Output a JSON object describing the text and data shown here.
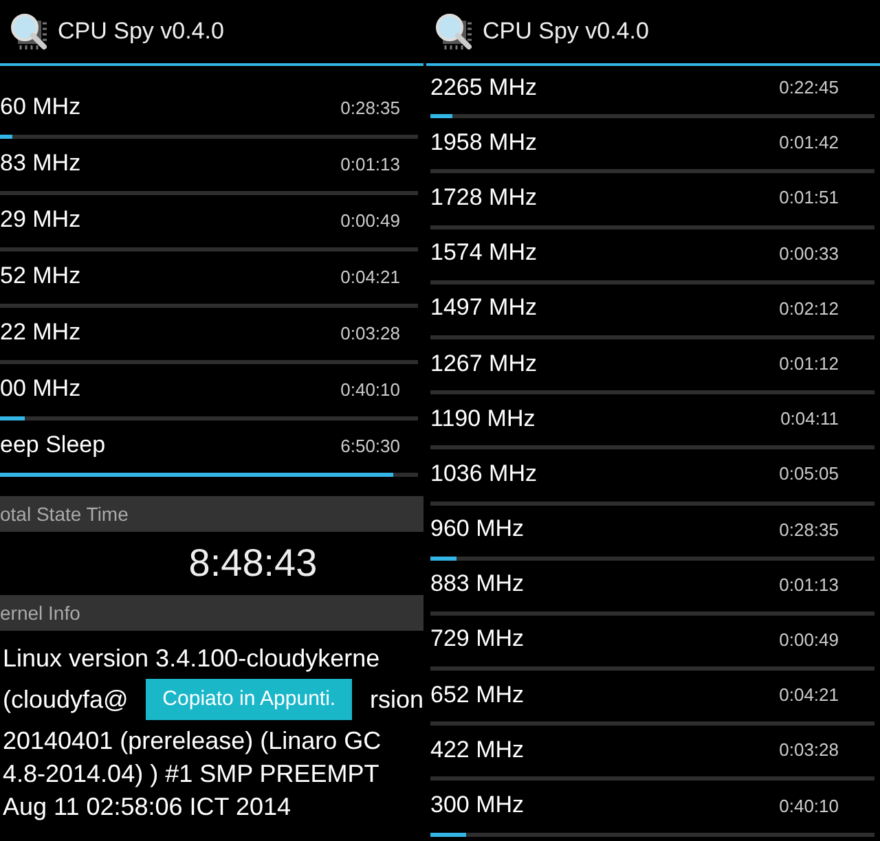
{
  "panels": [
    {
      "title": "CPU Spy v0.4.0",
      "states": [
        {
          "label": "60 MHz",
          "time": "0:28:35",
          "level": 0.03
        },
        {
          "label": "83 MHz",
          "time": "0:01:13",
          "level": 0
        },
        {
          "label": "29 MHz",
          "time": "0:00:49",
          "level": 0
        },
        {
          "label": "52 MHz",
          "time": "0:04:21",
          "level": 0
        },
        {
          "label": "22 MHz",
          "time": "0:03:28",
          "level": 0
        },
        {
          "label": "00 MHz",
          "time": "0:40:10",
          "level": 0.06
        },
        {
          "label": "eep Sleep",
          "time": "6:50:30",
          "level": 0.94
        }
      ],
      "total_header": "otal State Time",
      "total": "8:48:43",
      "kernel_header": "ernel Info",
      "kernel_lines": [
        {
          "text": "Linux version 3.4.100-cloudykerne"
        },
        {
          "left": "(cloudyfa@",
          "right": "rsion"
        },
        {
          "text": "20140401 (prerelease) (Linaro GC"
        },
        {
          "text": "4.8-2014.04) ) #1 SMP PREEMPT"
        },
        {
          "text": "Aug 11 02:58:06 ICT 2014"
        }
      ],
      "toast": "Copiato in Appunti."
    },
    {
      "title": "CPU Spy v0.4.0",
      "states": [
        {
          "label": "2265 MHz",
          "time": "0:22:45",
          "level": 0.05
        },
        {
          "label": "1958 MHz",
          "time": "0:01:42",
          "level": 0
        },
        {
          "label": "1728 MHz",
          "time": "0:01:51",
          "level": 0
        },
        {
          "label": "1574 MHz",
          "time": "0:00:33",
          "level": 0
        },
        {
          "label": "1497 MHz",
          "time": "0:02:12",
          "level": 0
        },
        {
          "label": "1267 MHz",
          "time": "0:01:12",
          "level": 0
        },
        {
          "label": "1190 MHz",
          "time": "0:04:11",
          "level": 0
        },
        {
          "label": "1036 MHz",
          "time": "0:05:05",
          "level": 0
        },
        {
          "label": "960 MHz",
          "time": "0:28:35",
          "level": 0.06
        },
        {
          "label": "883 MHz",
          "time": "0:01:13",
          "level": 0
        },
        {
          "label": "729 MHz",
          "time": "0:00:49",
          "level": 0
        },
        {
          "label": "652 MHz",
          "time": "0:04:21",
          "level": 0
        },
        {
          "label": "422 MHz",
          "time": "0:03:28",
          "level": 0
        },
        {
          "label": "300 MHz",
          "time": "0:40:10",
          "level": 0.08
        }
      ]
    }
  ]
}
